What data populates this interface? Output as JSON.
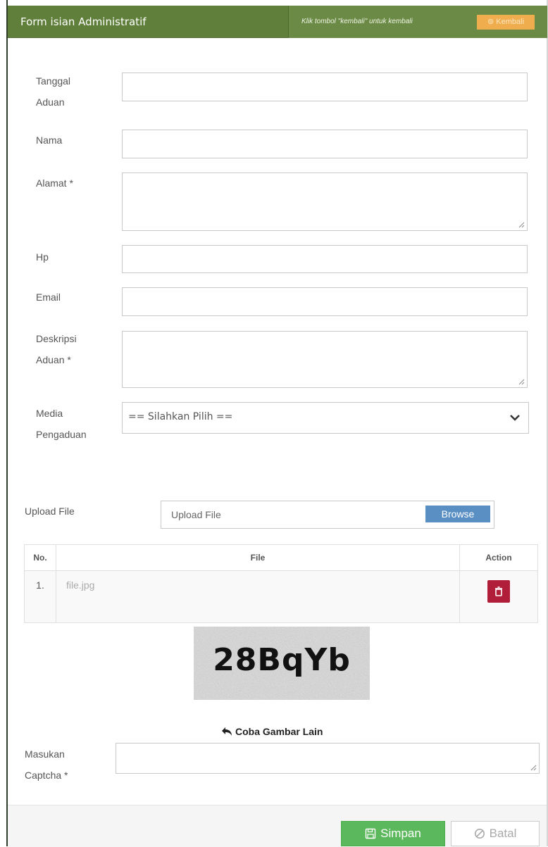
{
  "header": {
    "title": "Form isian Administratif",
    "hint": "Klik tombol \"kembali\" untuk kembali",
    "back_label": "Kembali",
    "color": "#5f7f3a"
  },
  "form": {
    "tanggal_label": "Tanggal\nAduan",
    "nama_label": "Nama",
    "alamat_label": "Alamat *",
    "hp_label": "Hp",
    "email_label": "Email",
    "deskripsi_label": "Deskripsi\nAduan *",
    "media_label": "Media\nPengaduan",
    "media_selected": "== Silahkan Pilih =="
  },
  "upload": {
    "label": "Upload File",
    "placeholder": "Upload File",
    "browse_label": "Browse"
  },
  "files_table": {
    "headers": [
      "No.",
      "File",
      "Action"
    ],
    "rows": [
      {
        "no": "1.",
        "file": "file.jpg"
      }
    ]
  },
  "captcha": {
    "image_text": "28BqYb",
    "refresh_label": "Coba Gambar Lain",
    "input_label": "Masukan\nCaptcha *"
  },
  "footer": {
    "save_label": "Simpan",
    "cancel_label": "Batal"
  }
}
